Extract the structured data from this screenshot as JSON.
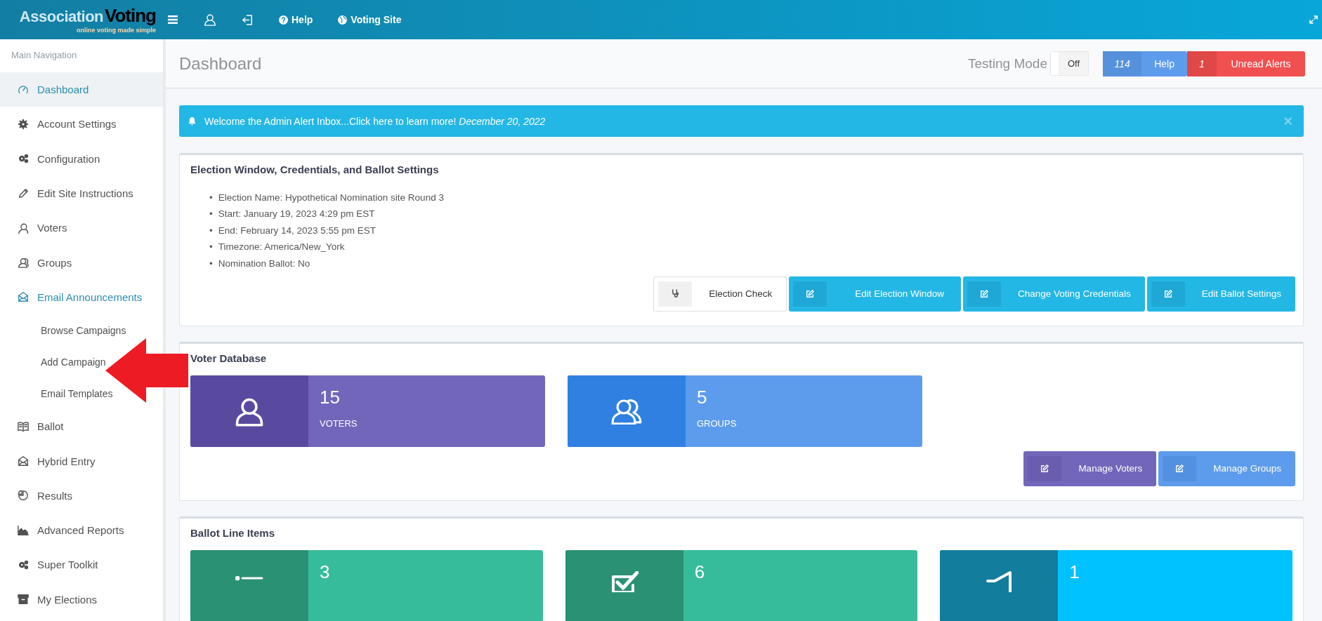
{
  "topbar": {
    "logo": {
      "word_1": "Association",
      "word_2": "Voting",
      "tagline": "online voting made simple"
    },
    "links": [
      {
        "kind": "menu"
      },
      {
        "kind": "user"
      },
      {
        "kind": "logout"
      },
      {
        "kind": "help",
        "label": "Help"
      },
      {
        "kind": "globe",
        "label": "Voting Site"
      }
    ]
  },
  "sidebar": {
    "heading": "Main Navigation",
    "items": [
      {
        "label": "Dashboard",
        "selected": true,
        "expanded": false
      },
      {
        "label": "Account Settings",
        "selected": false,
        "expanded": false
      },
      {
        "label": "Configuration",
        "selected": false,
        "expanded": false
      },
      {
        "label": "Edit Site Instructions",
        "selected": false,
        "expanded": false
      },
      {
        "label": "Voters",
        "selected": false,
        "expanded": false
      },
      {
        "label": "Groups",
        "selected": false,
        "expanded": false
      },
      {
        "label": "Email Announcements",
        "selected": false,
        "expanded": true,
        "children": [
          {
            "label": "Browse Campaigns"
          },
          {
            "label": "Add Campaign"
          },
          {
            "label": "Email Templates"
          }
        ]
      },
      {
        "label": "Ballot",
        "selected": false,
        "expanded": false
      },
      {
        "label": "Hybrid Entry",
        "selected": false,
        "expanded": false
      },
      {
        "label": "Results",
        "selected": false,
        "expanded": false
      },
      {
        "label": "Advanced Reports",
        "selected": false,
        "expanded": false
      },
      {
        "label": "Super Toolkit",
        "selected": false,
        "expanded": false
      },
      {
        "label": "My Elections",
        "selected": false,
        "expanded": false
      }
    ]
  },
  "annotations": [
    {
      "kind": "arrow",
      "color": "#ed1c24"
    }
  ],
  "header": {
    "title": "Dashboard",
    "testing_mode": {
      "label": "Testing Mode",
      "on": false,
      "state_text": "Off"
    },
    "buttons": [
      {
        "kind": "help",
        "count": "114",
        "label": "Help"
      },
      {
        "kind": "alerts",
        "count": "1",
        "label": "Unread Alerts"
      }
    ]
  },
  "alert": {
    "text": "Welcome the Admin Alert Inbox...Click here to learn more!",
    "date": "December 20, 2022",
    "close": "×"
  },
  "election_panel": {
    "title": "Election Window, Credentials, and Ballot Settings",
    "bullet": "•",
    "details": [
      "Election Name: Hypothetical Nomination site Round 3",
      "Start: January 19, 2023 4:29 pm EST",
      "End: February 14, 2023 5:55 pm EST",
      "Timezone: America/New_York",
      "Nomination Ballot: No"
    ],
    "buttons": [
      {
        "kind": "check",
        "label": "Election Check"
      },
      {
        "kind": "edit",
        "label": "Edit Election Window"
      },
      {
        "kind": "edit",
        "label": "Change Voting Credentials"
      },
      {
        "kind": "edit",
        "label": "Edit Ballot Settings"
      }
    ]
  },
  "voter_panel": {
    "title": "Voter Database",
    "stats": [
      {
        "kind": "voters",
        "value": "15",
        "label": "VOTERS"
      },
      {
        "kind": "groups",
        "value": "5",
        "label": "GROUPS"
      }
    ],
    "buttons": [
      {
        "kind": "voters",
        "label": "Manage Voters"
      },
      {
        "kind": "groups",
        "label": "Manage Groups"
      }
    ]
  },
  "ballot_panel": {
    "title": "Ballot Line Items",
    "stats": [
      {
        "kind": "list",
        "value": "3"
      },
      {
        "kind": "check",
        "value": "6"
      },
      {
        "kind": "announce",
        "value": "1"
      }
    ]
  }
}
